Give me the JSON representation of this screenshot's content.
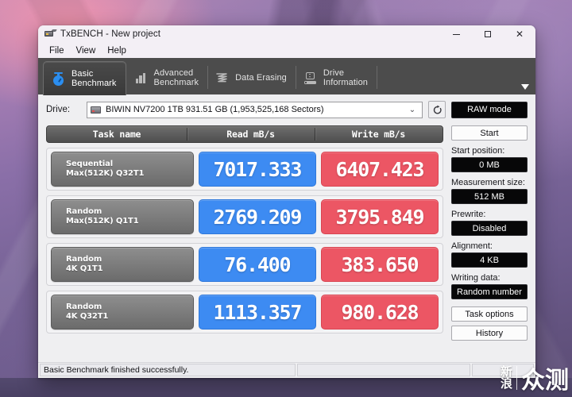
{
  "window": {
    "title": "TxBENCH - New project",
    "icon": "drive-icon",
    "controls": {
      "minimize": "–",
      "maximize": "□",
      "close": "✕"
    }
  },
  "menubar": {
    "items": [
      {
        "label": "File"
      },
      {
        "label": "View"
      },
      {
        "label": "Help"
      }
    ]
  },
  "tabs": {
    "items": [
      {
        "label": "Basic\nBenchmark",
        "icon": "stopwatch-icon",
        "active": true
      },
      {
        "label": "Advanced\nBenchmark",
        "icon": "bar-chart-icon",
        "active": false
      },
      {
        "label": "Data Erasing",
        "icon": "shred-icon",
        "active": false
      },
      {
        "label": "Drive\nInformation",
        "icon": "drive-info-icon",
        "active": false
      }
    ],
    "overflow_icon": "chevron-down-icon"
  },
  "drive_bar": {
    "label": "Drive:",
    "selected": "BIWIN NV7200  1TB  931.51 GB (1,953,525,168 Sectors)",
    "dropdown_icon": "chevron-down-icon",
    "refresh_icon": "refresh-icon",
    "raw_mode_label": "RAW mode"
  },
  "table": {
    "headers": {
      "task": "Task name",
      "read": "Read mB/s",
      "write": "Write mB/s"
    },
    "rows": [
      {
        "task_line1": "Sequential",
        "task_line2": "Max(512K) Q32T1",
        "read": "7017.333",
        "write": "6407.423"
      },
      {
        "task_line1": "Random",
        "task_line2": "Max(512K) Q1T1",
        "read": "2769.209",
        "write": "3795.849"
      },
      {
        "task_line1": "Random",
        "task_line2": "4K Q1T1",
        "read": "76.400",
        "write": "383.650"
      },
      {
        "task_line1": "Random",
        "task_line2": "4K Q32T1",
        "read": "1113.357",
        "write": "980.628"
      }
    ]
  },
  "sidebar": {
    "start_label": "Start",
    "fields": [
      {
        "label": "Start position:",
        "value": "0 MB"
      },
      {
        "label": "Measurement size:",
        "value": "512 MB"
      },
      {
        "label": "Prewrite:",
        "value": "Disabled"
      },
      {
        "label": "Alignment:",
        "value": "4 KB"
      },
      {
        "label": "Writing data:",
        "value": "Random number"
      }
    ],
    "task_options_label": "Task options",
    "history_label": "History"
  },
  "statusbar": {
    "message": "Basic Benchmark finished successfully.",
    "segment2": "",
    "segment3": ""
  },
  "watermark": {
    "small": "新\n浪",
    "big": "众测"
  },
  "colors": {
    "read_blue": "#3d8bf2",
    "write_red": "#ec5664",
    "tabstrip_bg": "#4c4c4c",
    "window_bg": "#efeff1",
    "accent_black": "#070708"
  }
}
